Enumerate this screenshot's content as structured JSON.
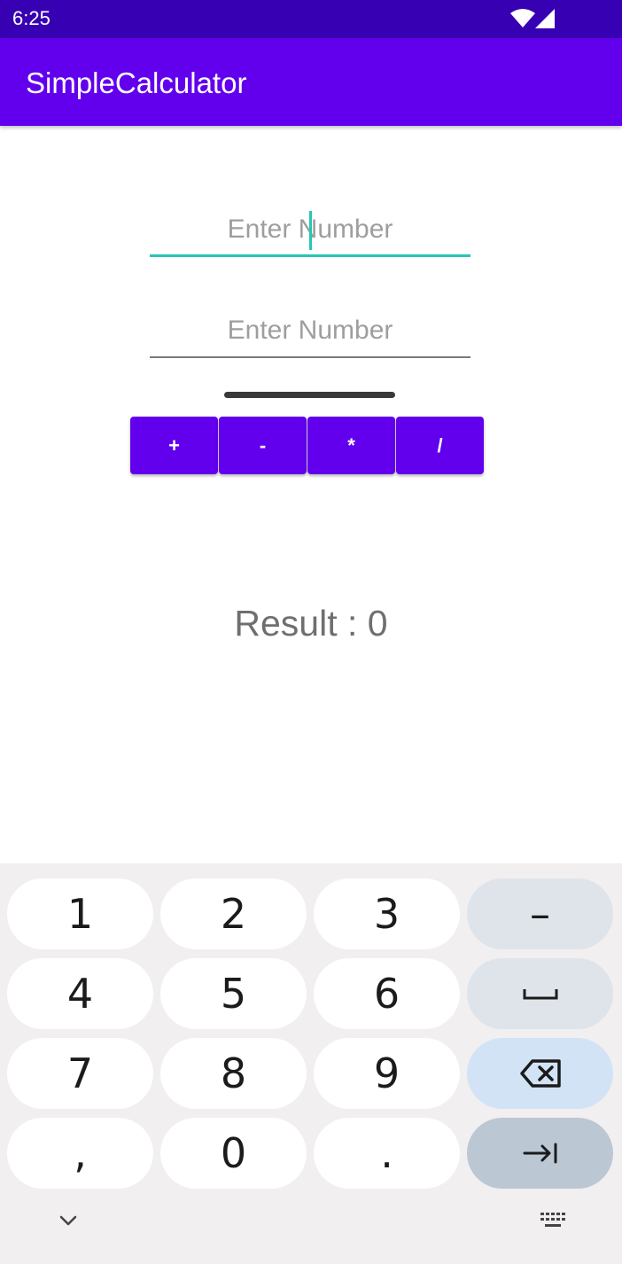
{
  "status_bar": {
    "time": "6:25",
    "icons": [
      "wifi-icon",
      "cell-signal-icon"
    ]
  },
  "app_bar": {
    "title": "SimpleCalculator"
  },
  "inputs": [
    {
      "placeholder": "Enter Number",
      "value": ""
    },
    {
      "placeholder": "Enter Number",
      "value": ""
    }
  ],
  "operations": [
    "+",
    "-",
    "*",
    "/"
  ],
  "result": {
    "text": "Result : 0"
  },
  "keyboard": {
    "keys": [
      "1",
      "2",
      "3",
      "4",
      "5",
      "6",
      "7",
      "8",
      "9",
      ",",
      "0",
      "."
    ],
    "func_keys": [
      "dash-key",
      "space-key",
      "backspace-key",
      "tab-next-key"
    ],
    "dash_label": "–"
  },
  "colors": {
    "status_bar": "#3700b3",
    "primary": "#6200ee",
    "accent": "#26c6b5",
    "placeholder": "#9e9e9e",
    "result": "#6f6f6f"
  }
}
